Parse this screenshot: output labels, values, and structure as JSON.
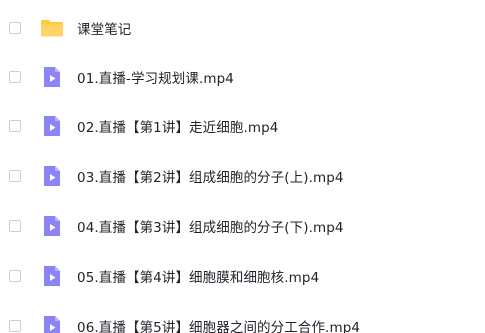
{
  "colors": {
    "folder": "#ffc83d",
    "video_icon": "#8b84f6",
    "text": "#1f2329",
    "checkbox_border": "#c9ced6"
  },
  "files": [
    {
      "name": "课堂笔记",
      "icon": "folder-icon"
    },
    {
      "name": "01.直播-学习规划课.mp4",
      "icon": "video-file-icon"
    },
    {
      "name": "02.直播【第1讲】走近细胞.mp4",
      "icon": "video-file-icon"
    },
    {
      "name": "03.直播【第2讲】组成细胞的分子(上).mp4",
      "icon": "video-file-icon"
    },
    {
      "name": "04.直播【第3讲】组成细胞的分子(下).mp4",
      "icon": "video-file-icon"
    },
    {
      "name": "05.直播【第4讲】细胞膜和细胞核.mp4",
      "icon": "video-file-icon"
    },
    {
      "name": "06.直播【第5讲】细胞器之间的分工合作.mp4",
      "icon": "video-file-icon"
    }
  ]
}
